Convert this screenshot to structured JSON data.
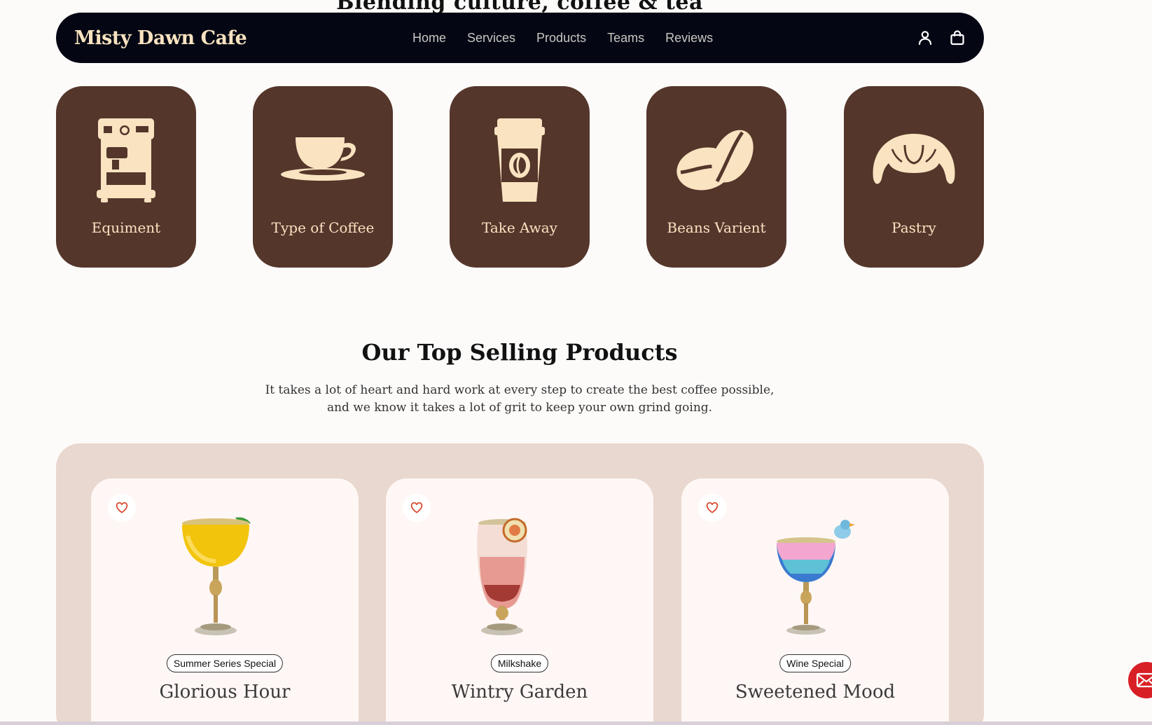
{
  "peek_heading": "Blending culture, coffee & tea",
  "nav": {
    "brand": "Misty Dawn Cafe",
    "links": [
      "Home",
      "Services",
      "Products",
      "Teams",
      "Reviews"
    ],
    "icons": [
      "user-icon",
      "shopping-bag-icon"
    ]
  },
  "categories": [
    {
      "label": "Equiment",
      "icon": "espresso-machine-icon"
    },
    {
      "label": "Type of Coffee",
      "icon": "coffee-cup-icon"
    },
    {
      "label": "Take Away",
      "icon": "takeaway-cup-icon"
    },
    {
      "label": "Beans Varient",
      "icon": "coffee-beans-icon"
    },
    {
      "label": "Pastry",
      "icon": "croissant-icon"
    }
  ],
  "top_selling": {
    "title": "Our Top Selling Products",
    "subtitle_line1": "It takes a lot of heart and hard work at every step to create the best coffee possible,",
    "subtitle_line2": "and we know it takes a lot of grit to keep your own grind going."
  },
  "products": [
    {
      "badge": "Summer Series Special",
      "name": "Glorious Hour",
      "icon": "heart-icon"
    },
    {
      "badge": "Milkshake",
      "name": "Wintry Garden",
      "icon": "heart-icon"
    },
    {
      "badge": "Wine Special",
      "name": "Sweetened Mood",
      "icon": "heart-icon"
    }
  ],
  "colors": {
    "nav_bg": "#040713",
    "brand": "#f8e2c0",
    "category_bg": "#54362b",
    "category_fg": "#f9e3c0",
    "panel_bg": "#e9d8cf",
    "card_bg": "#fff7f5",
    "heart": "#d9472b",
    "mail_button": "#d81f26"
  }
}
